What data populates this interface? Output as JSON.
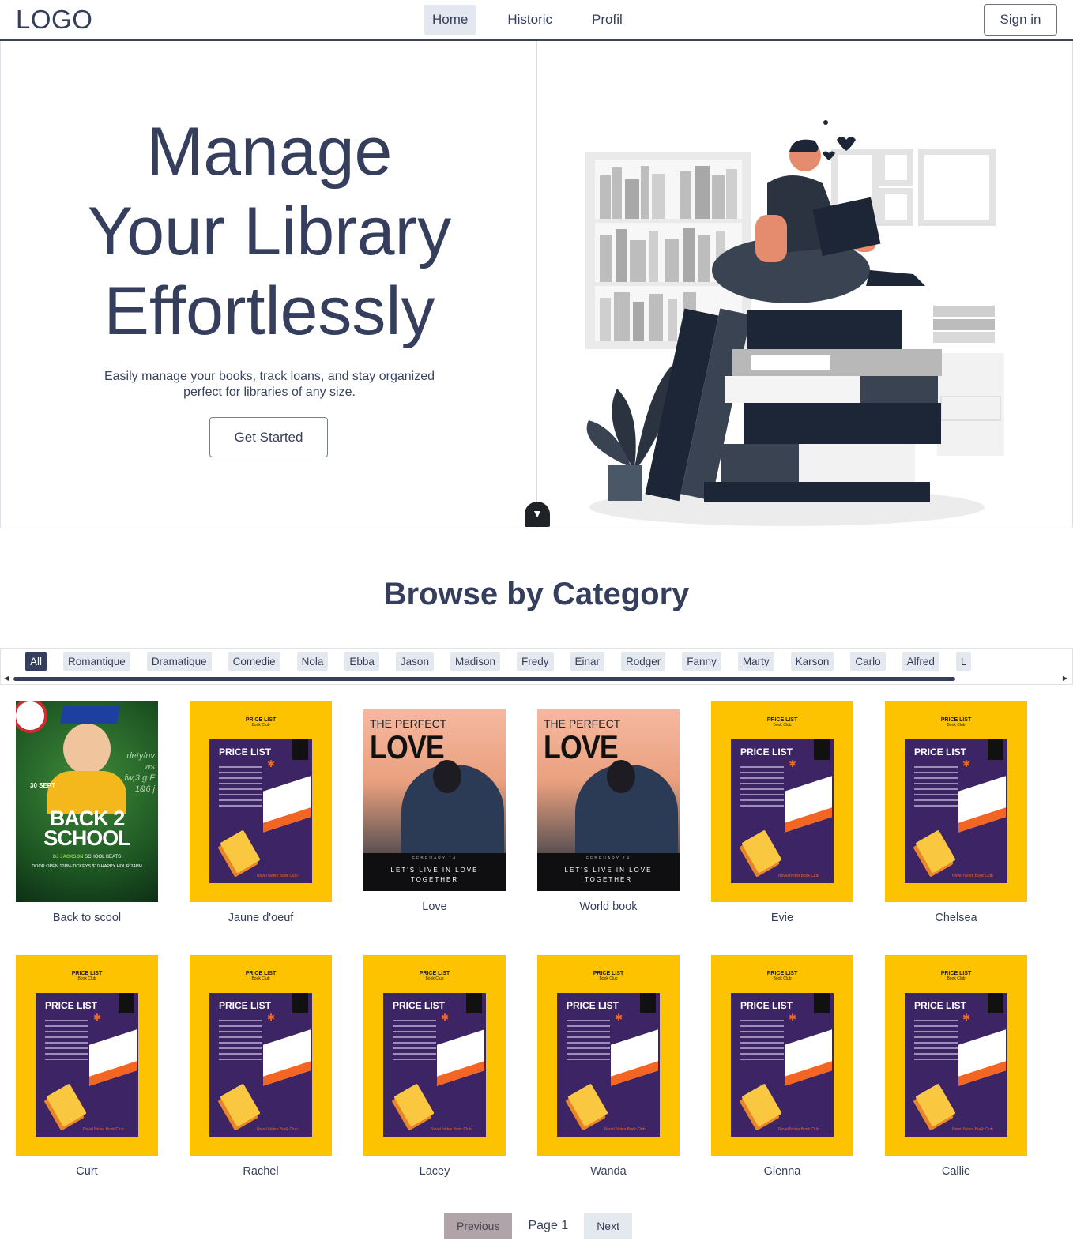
{
  "nav": {
    "logo": "LOGO",
    "links": [
      "Home",
      "Historic",
      "Profil"
    ],
    "signin": "Sign in"
  },
  "hero": {
    "title_lines": [
      "Manage",
      "Your Library",
      "Effortlessly"
    ],
    "subtitle_line1": "Easily manage your books, track loans, and stay organized",
    "subtitle_line2": "perfect for libraries of any size.",
    "cta": "Get Started",
    "scroll_icon": "chevron-down-icon"
  },
  "browse": {
    "title": "Browse by Category",
    "categories": [
      "All",
      "Romantique",
      "Dramatique",
      "Comedie",
      "Nola",
      "Ebba",
      "Jason",
      "Madison",
      "Fredy",
      "Einar",
      "Rodger",
      "Fanny",
      "Marty",
      "Karson",
      "Carlo",
      "Alfred",
      "L"
    ],
    "active_category": "All"
  },
  "books": [
    {
      "title": "Back to scool",
      "cover": "school"
    },
    {
      "title": "Jaune d'oeuf",
      "cover": "price-list"
    },
    {
      "title": "Love",
      "cover": "love"
    },
    {
      "title": "World book",
      "cover": "love"
    },
    {
      "title": "Evie",
      "cover": "price-list"
    },
    {
      "title": "Chelsea",
      "cover": "price-list"
    },
    {
      "title": "Curt",
      "cover": "price-list"
    },
    {
      "title": "Rachel",
      "cover": "price-list"
    },
    {
      "title": "Lacey",
      "cover": "price-list"
    },
    {
      "title": "Wanda",
      "cover": "price-list"
    },
    {
      "title": "Glenna",
      "cover": "price-list"
    },
    {
      "title": "Callie",
      "cover": "price-list"
    }
  ],
  "covers": {
    "price_list": {
      "header": "PRICE LIST",
      "sub": "Book Club",
      "panel_title": "PRICE LIST",
      "footer": "Novel Notes Book Club"
    },
    "love": {
      "line1": "THE PERFECT",
      "line2": "LOVE",
      "date": "FEBRUARY 14",
      "slogan1": "LET'S LIVE IN LOVE",
      "slogan2": "TOGETHER"
    },
    "school": {
      "date": "30 SEPT",
      "line1": "BACK 2",
      "line2": "SCHOOL",
      "dj": "DJ JACKSON",
      "beats": "SCHOOL BEATS",
      "door": "DOOR OPEN 10PM-TICKEYS $10-HAPPY HOUR 24PM"
    }
  },
  "pagination": {
    "previous": "Previous",
    "page": "Page 1",
    "next": "Next"
  },
  "colors": {
    "primary": "#353e5c",
    "chip_bg": "#e4e8ef",
    "cover_yellow": "#fdc200",
    "cover_purple": "#3d2465",
    "prev_button": "#b0a4a9"
  }
}
